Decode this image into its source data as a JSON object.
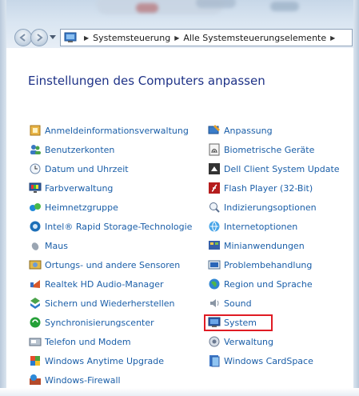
{
  "breadcrumb": [
    "Systemsteuerung",
    "Alle Systemsteuerungselemente"
  ],
  "page_title": "Einstellungen des Computers anpassen",
  "left_items": [
    {
      "label": "Anmeldeinformationsverwaltung",
      "icon": "credential-icon"
    },
    {
      "label": "Benutzerkonten",
      "icon": "users-icon"
    },
    {
      "label": "Datum und Uhrzeit",
      "icon": "clock-icon"
    },
    {
      "label": "Farbverwaltung",
      "icon": "color-monitor-icon"
    },
    {
      "label": "Heimnetzgruppe",
      "icon": "homegroup-icon"
    },
    {
      "label": "Intel® Rapid Storage-Technologie",
      "icon": "intel-icon"
    },
    {
      "label": "Maus",
      "icon": "mouse-icon"
    },
    {
      "label": "Ortungs- und andere Sensoren",
      "icon": "sensor-icon"
    },
    {
      "label": "Realtek HD Audio-Manager",
      "icon": "audio-icon"
    },
    {
      "label": "Sichern und Wiederherstellen",
      "icon": "backup-icon"
    },
    {
      "label": "Synchronisierungscenter",
      "icon": "sync-icon"
    },
    {
      "label": "Telefon und Modem",
      "icon": "phone-icon"
    },
    {
      "label": "Windows Anytime Upgrade",
      "icon": "windows-flag-icon"
    },
    {
      "label": "Windows-Firewall",
      "icon": "firewall-icon"
    }
  ],
  "right_items": [
    {
      "label": "Anpassung",
      "icon": "personalize-icon"
    },
    {
      "label": "Biometrische Geräte",
      "icon": "fingerprint-icon"
    },
    {
      "label": "Dell Client System Update",
      "icon": "dell-icon"
    },
    {
      "label": "Flash Player (32-Bit)",
      "icon": "flash-icon"
    },
    {
      "label": "Indizierungsoptionen",
      "icon": "search-index-icon"
    },
    {
      "label": "Internetoptionen",
      "icon": "internet-icon"
    },
    {
      "label": "Minianwendungen",
      "icon": "gadgets-icon"
    },
    {
      "label": "Problembehandlung",
      "icon": "troubleshoot-icon"
    },
    {
      "label": "Region und Sprache",
      "icon": "globe-icon"
    },
    {
      "label": "Sound",
      "icon": "speaker-icon"
    },
    {
      "label": "System",
      "icon": "system-icon",
      "highlighted": true
    },
    {
      "label": "Verwaltung",
      "icon": "admin-tools-icon"
    },
    {
      "label": "Windows CardSpace",
      "icon": "cardspace-icon"
    }
  ],
  "colors": {
    "link": "#1a5ea8",
    "title": "#1e3287",
    "highlight": "#e01b24"
  }
}
